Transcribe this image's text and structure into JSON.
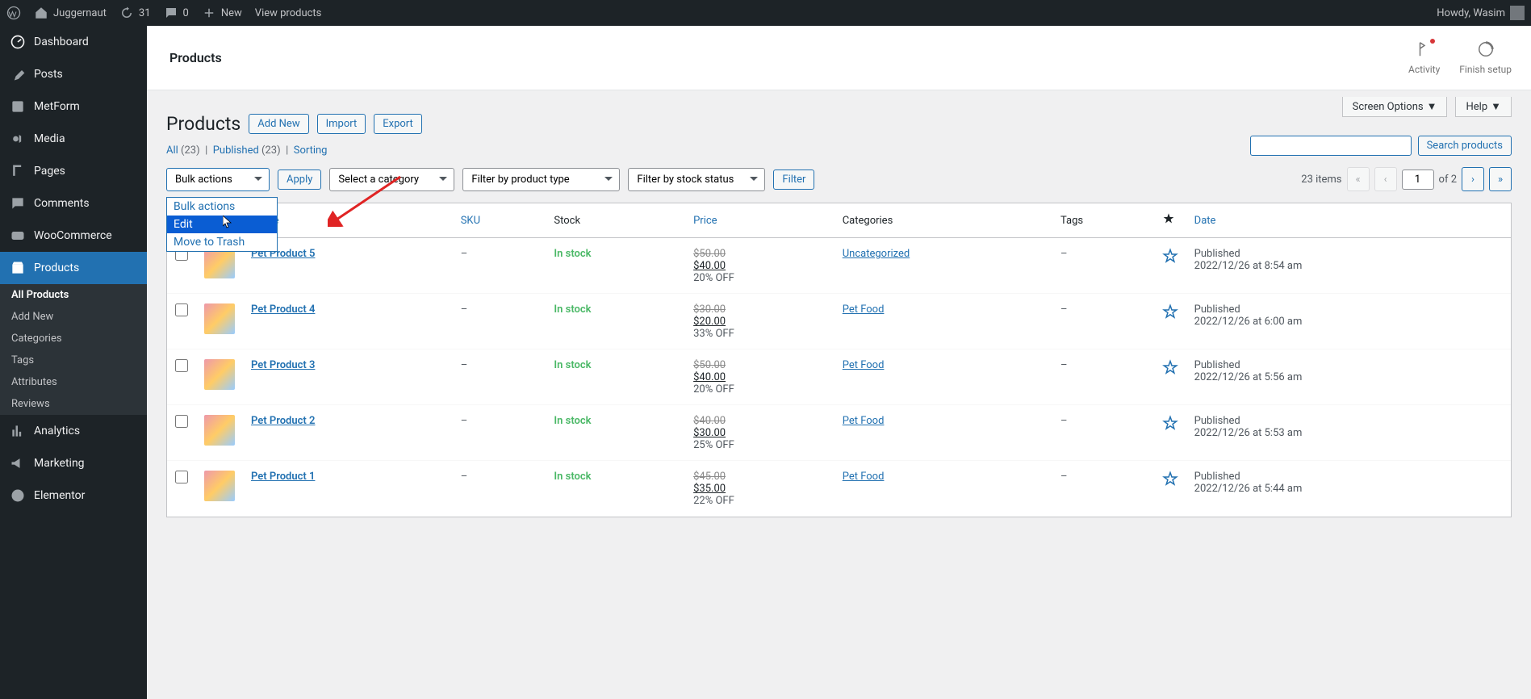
{
  "adminbar": {
    "site_name": "Juggernaut",
    "updates": "31",
    "comments": "0",
    "new": "New",
    "view": "View products",
    "howdy": "Howdy, Wasim"
  },
  "sidebar": {
    "items": [
      {
        "label": "Dashboard",
        "icon": "dash"
      },
      {
        "label": "Posts",
        "icon": "pin"
      },
      {
        "label": "MetForm",
        "icon": "form"
      },
      {
        "label": "Media",
        "icon": "media"
      },
      {
        "label": "Pages",
        "icon": "page"
      },
      {
        "label": "Comments",
        "icon": "comment"
      },
      {
        "label": "WooCommerce",
        "icon": "woo"
      },
      {
        "label": "Products",
        "icon": "box",
        "current": true
      },
      {
        "label": "Analytics",
        "icon": "chart"
      },
      {
        "label": "Marketing",
        "icon": "mega"
      },
      {
        "label": "Elementor",
        "icon": "elem"
      }
    ],
    "products_submenu": [
      {
        "label": "All Products",
        "current": true
      },
      {
        "label": "Add New"
      },
      {
        "label": "Categories"
      },
      {
        "label": "Tags"
      },
      {
        "label": "Attributes"
      },
      {
        "label": "Reviews"
      }
    ]
  },
  "header": {
    "title": "Products",
    "activity": "Activity",
    "finish": "Finish setup"
  },
  "screen_opts": {
    "screen": "Screen Options",
    "help": "Help"
  },
  "page": {
    "title": "Products",
    "add_new": "Add New",
    "import": "Import",
    "export": "Export"
  },
  "subsubsub": {
    "all": "All",
    "all_cnt": "(23)",
    "pub": "Published",
    "pub_cnt": "(23)",
    "sort": "Sorting"
  },
  "search": {
    "btn": "Search products"
  },
  "filters": {
    "bulk": "Bulk actions",
    "apply": "Apply",
    "cat": "Select a category",
    "type": "Filter by product type",
    "stock": "Filter by stock status",
    "filter": "Filter"
  },
  "bulk_dropdown": {
    "opt0": "Bulk actions",
    "opt1": "Edit",
    "opt2": "Move to Trash"
  },
  "pager": {
    "items": "23 items",
    "page": "1",
    "of": "of 2"
  },
  "table": {
    "cols": {
      "name": "Name",
      "sku": "SKU",
      "stock": "Stock",
      "price": "Price",
      "cat": "Categories",
      "tags": "Tags",
      "date": "Date"
    },
    "rows": [
      {
        "name": "Pet Product 5",
        "sku": "–",
        "stock": "In stock",
        "old": "$50.00",
        "new": "$40.00",
        "off": "20% OFF",
        "cat": "Uncategorized",
        "tags": "–",
        "pub": "Published",
        "date": "2022/12/26 at 8:54 am"
      },
      {
        "name": "Pet Product 4",
        "sku": "–",
        "stock": "In stock",
        "old": "$30.00",
        "new": "$20.00",
        "off": "33% OFF",
        "cat": "Pet Food",
        "tags": "–",
        "pub": "Published",
        "date": "2022/12/26 at 6:00 am"
      },
      {
        "name": "Pet Product 3",
        "sku": "–",
        "stock": "In stock",
        "old": "$50.00",
        "new": "$40.00",
        "off": "20% OFF",
        "cat": "Pet Food",
        "tags": "–",
        "pub": "Published",
        "date": "2022/12/26 at 5:56 am"
      },
      {
        "name": "Pet Product 2",
        "sku": "–",
        "stock": "In stock",
        "old": "$40.00",
        "new": "$30.00",
        "off": "25% OFF",
        "cat": "Pet Food",
        "tags": "–",
        "pub": "Published",
        "date": "2022/12/26 at 5:53 am"
      },
      {
        "name": "Pet Product 1",
        "sku": "–",
        "stock": "In stock",
        "old": "$45.00",
        "new": "$35.00",
        "off": "22% OFF",
        "cat": "Pet Food",
        "tags": "–",
        "pub": "Published",
        "date": "2022/12/26 at 5:44 am"
      }
    ]
  }
}
